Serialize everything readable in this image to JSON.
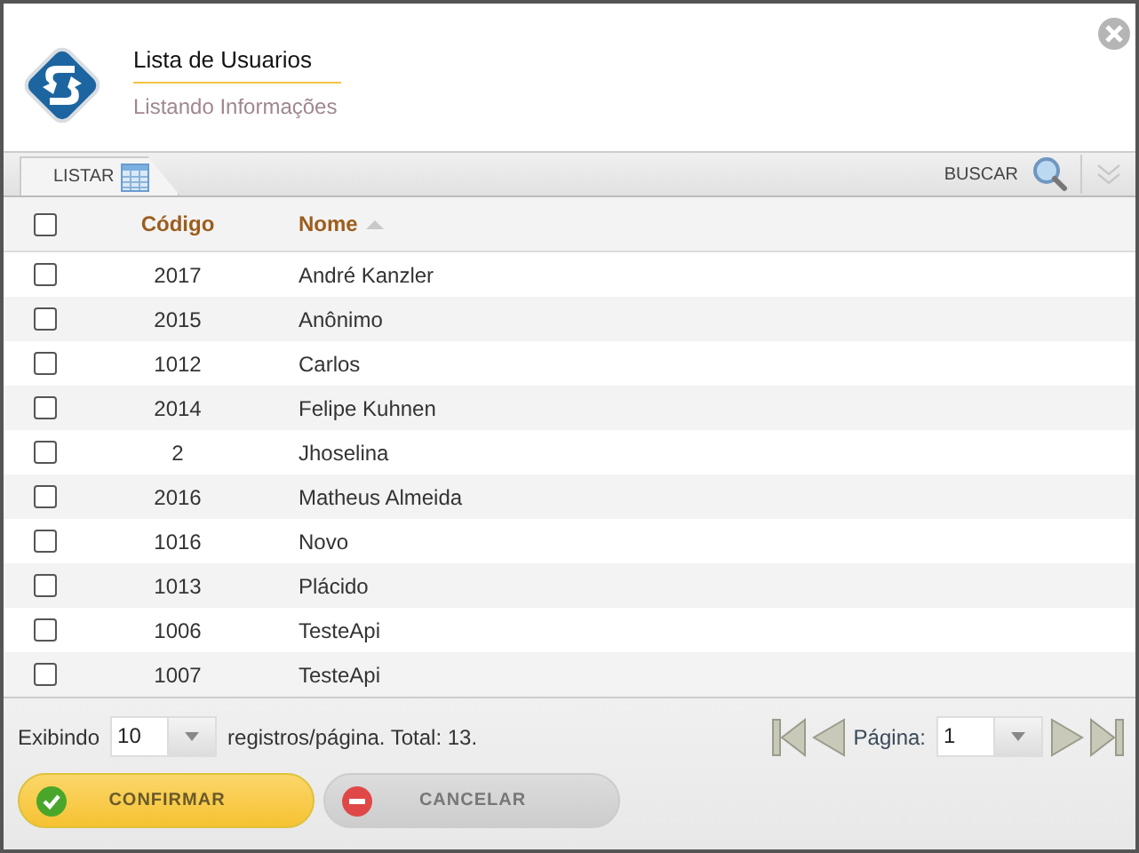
{
  "header": {
    "title": "Lista de Usuarios",
    "subtitle": "Listando Informações"
  },
  "tabs": [
    {
      "label": "LISTAR",
      "selected": true
    }
  ],
  "search": {
    "label": "BUSCAR"
  },
  "table": {
    "select_all": {
      "checked": false
    },
    "columns": [
      {
        "label": "Código",
        "sorted": false
      },
      {
        "label": "Nome",
        "sorted": true
      }
    ],
    "rows": [
      {
        "checked": false,
        "code": "2017",
        "name": "André Kanzler"
      },
      {
        "checked": false,
        "code": "2015",
        "name": "Anônimo"
      },
      {
        "checked": false,
        "code": "1012",
        "name": "Carlos"
      },
      {
        "checked": false,
        "code": "2014",
        "name": "Felipe Kuhnen"
      },
      {
        "checked": false,
        "code": "2",
        "name": "Jhoselina"
      },
      {
        "checked": false,
        "code": "2016",
        "name": "Matheus Almeida"
      },
      {
        "checked": false,
        "code": "1016",
        "name": "Novo"
      },
      {
        "checked": false,
        "code": "1013",
        "name": "Plácido"
      },
      {
        "checked": false,
        "code": "1006",
        "name": "TesteApi"
      },
      {
        "checked": false,
        "code": "1007",
        "name": "TesteApi"
      }
    ]
  },
  "footer": {
    "showing_label": "Exibindo",
    "page_size": "10",
    "records_text": "registros/página. Total: 13.",
    "page_label": "Página:",
    "page": "1"
  },
  "buttons": [
    {
      "label": "CONFIRMAR",
      "kind": "confirm"
    },
    {
      "label": "CANCELAR",
      "kind": "cancel"
    }
  ]
}
